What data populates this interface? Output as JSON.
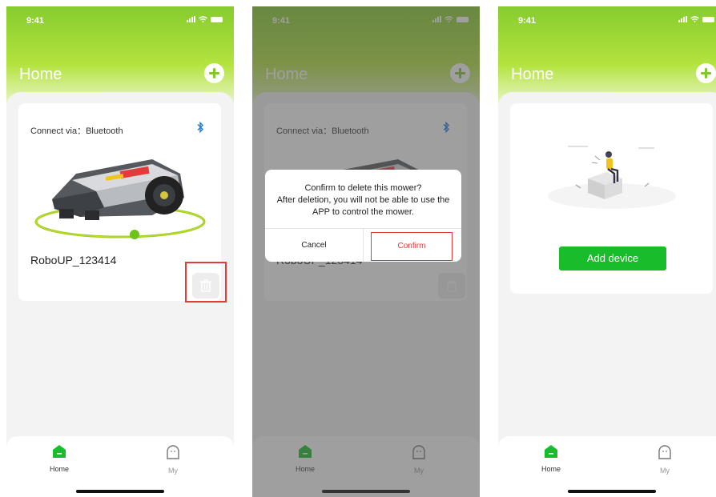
{
  "status_bar": {
    "time": "9:41"
  },
  "header": {
    "title": "Home"
  },
  "device_card": {
    "connect_label": "Connect via：Bluetooth",
    "device_name": "RoboUP_123414",
    "connection_icon": "bluetooth-icon",
    "delete_icon": "trash-icon"
  },
  "delete_dialog": {
    "line1": "Confirm to delete this mower?",
    "line2": "After deletion, you will not be able to use the",
    "line3": "APP to control the mower.",
    "cancel_label": "Cancel",
    "confirm_label": "Confirm"
  },
  "empty_state": {
    "add_device_label": "Add device"
  },
  "tab_bar": {
    "tabs": [
      {
        "label": "Home",
        "icon": "home-icon",
        "active": true
      },
      {
        "label": "My",
        "icon": "profile-face-icon",
        "active": false
      }
    ]
  },
  "colors": {
    "accent_green": "#7fc92a",
    "button_green": "#19bd2c",
    "highlight_red": "#e23b3b",
    "bluetooth_blue": "#1f7ae0"
  }
}
